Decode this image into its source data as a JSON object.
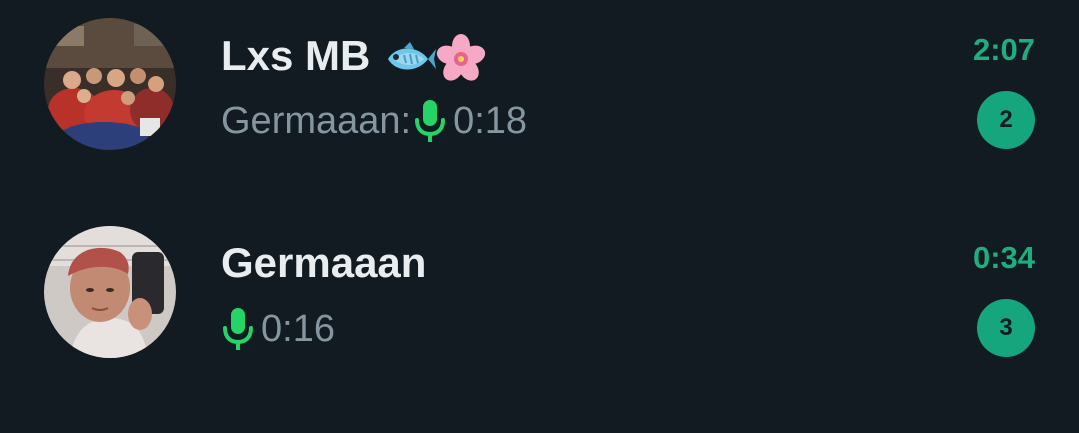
{
  "colors": {
    "background": "#111b21",
    "name_text": "#e9edef",
    "preview_text": "#8696a0",
    "accent_green": "#1fae7e",
    "mic_green": "#25d366",
    "badge_bg": "#16a67e"
  },
  "chats": [
    {
      "name": "Lxs MB",
      "name_emojis": [
        "fish-emoji",
        "cherry-blossom-emoji"
      ],
      "sender": "Germaaan:",
      "message_icon": "microphone-icon",
      "duration": "0:18",
      "time": "2:07",
      "unread": "2"
    },
    {
      "name": "Germaaan",
      "message_icon": "microphone-icon",
      "duration": "0:16",
      "time": "0:34",
      "unread": "3"
    }
  ]
}
